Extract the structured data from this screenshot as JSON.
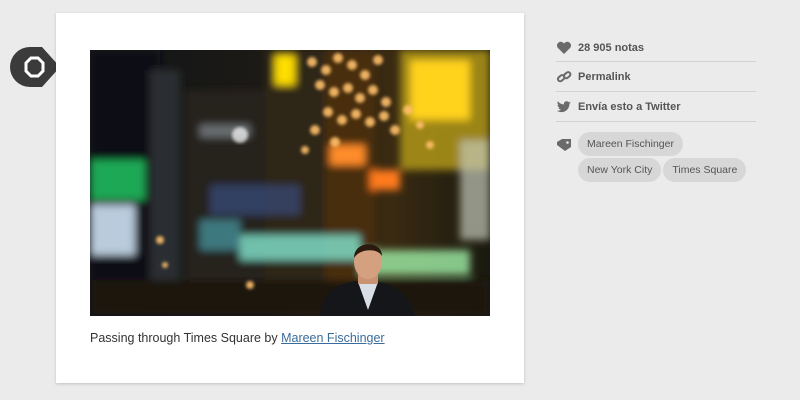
{
  "post": {
    "caption_prefix": "Passing through Times Square by ",
    "caption_link": "Mareen Fischinger"
  },
  "sidebar": {
    "notes": "28 905 notas",
    "permalink": "Permalink",
    "twitter": "Envía esto a Twitter",
    "tags": [
      "Mareen Fischinger",
      "New York City",
      "Times Square"
    ]
  },
  "icons": {
    "post_type": "camera-icon",
    "notes": "heart-icon",
    "permalink": "link-icon",
    "twitter": "twitter-bird-icon",
    "tags": "tag-icon"
  },
  "colors": {
    "background": "#ebebeb",
    "card": "#ffffff",
    "link": "#3a6c9c",
    "tag_bg": "#d7d7d7",
    "marker": "#3b3b3b"
  }
}
